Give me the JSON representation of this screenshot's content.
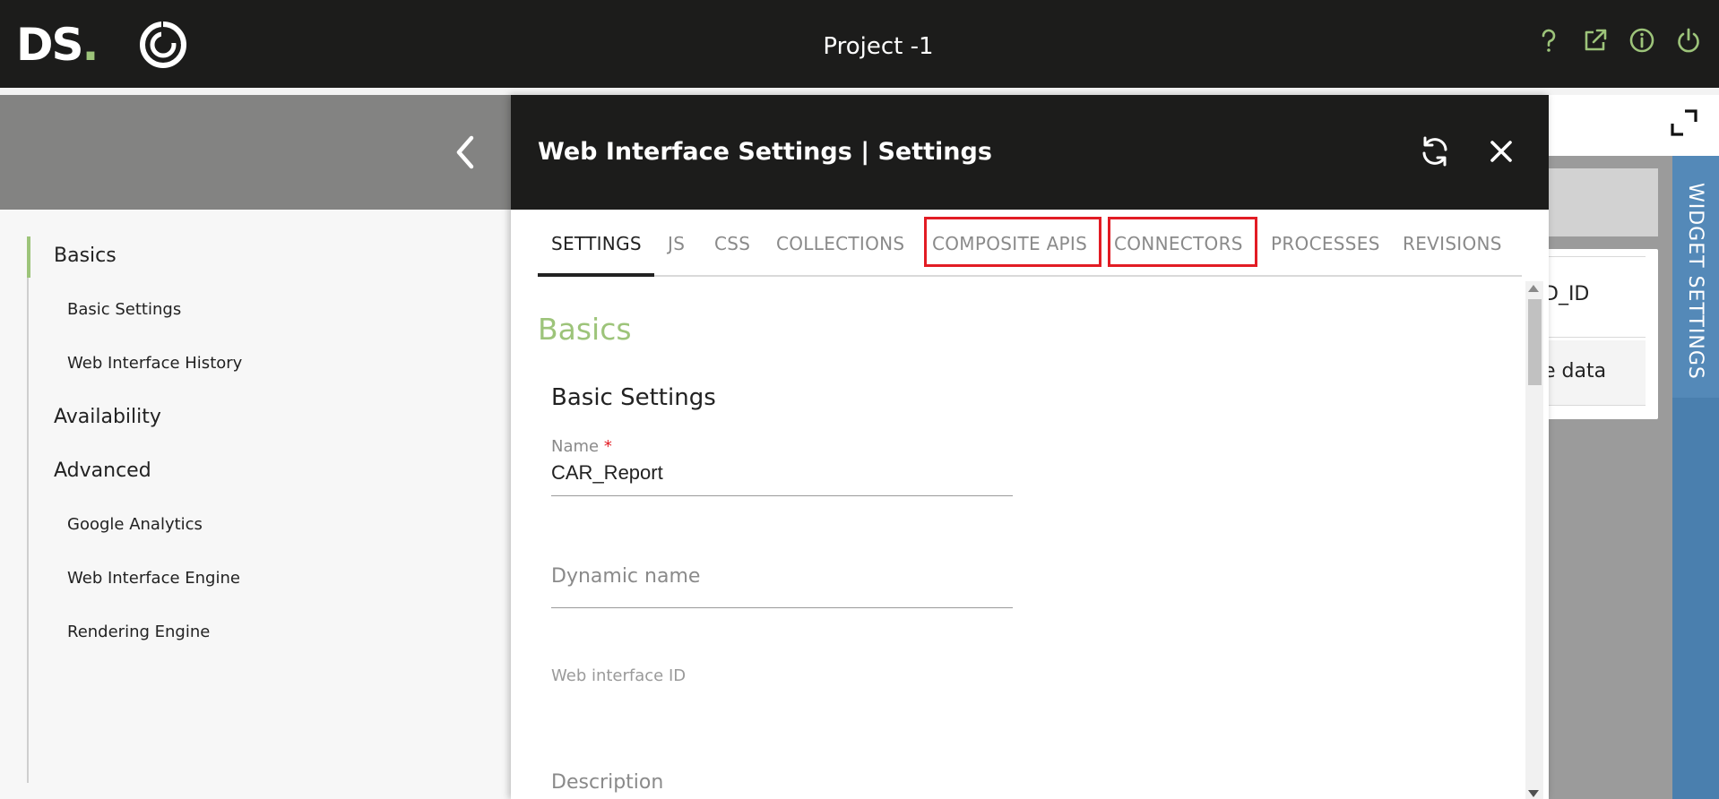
{
  "app": {
    "logo_text": "DS",
    "logo_dot": ".",
    "project_title": "Project -1"
  },
  "header_icons": [
    "help-icon",
    "external-link-icon",
    "info-icon",
    "power-icon"
  ],
  "colors": {
    "accent_green": "#9dc47a",
    "header_bg": "#1c1c1b",
    "widget_tab_blue": "#4a7fae",
    "highlight_red": "#e21c24"
  },
  "sidebar": {
    "items": [
      {
        "label": "Basics",
        "level": "main",
        "active": true
      },
      {
        "label": "Basic Settings",
        "level": "sub"
      },
      {
        "label": "Web Interface History",
        "level": "sub"
      },
      {
        "label": "Availability",
        "level": "main"
      },
      {
        "label": "Advanced",
        "level": "main"
      },
      {
        "label": "Google Analytics",
        "level": "sub"
      },
      {
        "label": "Web Interface Engine",
        "level": "sub"
      },
      {
        "label": "Rendering Engine",
        "level": "sub"
      }
    ]
  },
  "modal": {
    "title": "Web Interface Settings | Settings",
    "tabs": [
      {
        "label": "SETTINGS",
        "active": true
      },
      {
        "label": "JS"
      },
      {
        "label": "CSS"
      },
      {
        "label": "COLLECTIONS"
      },
      {
        "label": "COMPOSITE APIS",
        "highlighted": true
      },
      {
        "label": "CONNECTORS",
        "highlighted": true
      },
      {
        "label": "PROCESSES"
      },
      {
        "label": "REVISIONS"
      }
    ],
    "section_title": "Basics",
    "sub_title": "Basic Settings",
    "fields": {
      "name_label": "Name",
      "name_required": "*",
      "name_value": "CAR_Report",
      "dynamic_name_placeholder": "Dynamic name",
      "web_interface_id_label": "Web interface ID",
      "description_placeholder": "Description"
    }
  },
  "background": {
    "partial_text_1": "D_ID",
    "partial_text_2": "e data",
    "widget_tab_label": "WIDGET SETTINGS"
  }
}
